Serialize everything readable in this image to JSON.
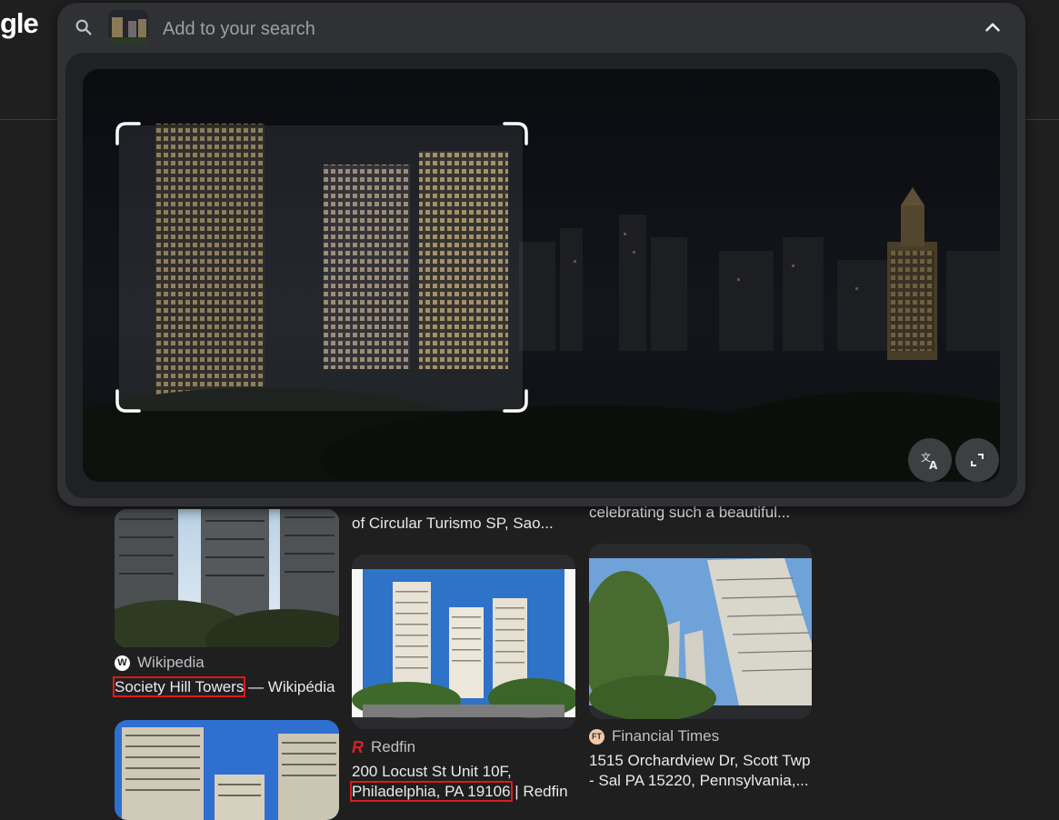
{
  "page": {
    "logo_fragment": "gle"
  },
  "search": {
    "placeholder": "Add to your search",
    "collapse_icon": "chevron-up-icon",
    "translate_icon": "translate-icon",
    "fullscreen_icon": "expand-icon"
  },
  "results": [
    {
      "snippet_above": "",
      "source": "Wikipedia",
      "favicon": "W",
      "title_highlight": "Society Hill Towers",
      "title_rest": " — Wikipédia"
    },
    {
      "snippet_above": "",
      "source": "",
      "favicon": "",
      "title_highlight": "",
      "title_rest": ""
    },
    {
      "snippet_above": "of Circular Turismo SP, Sao...",
      "source": "Redfin",
      "favicon": "R",
      "title_line1": "200 Locust St Unit 10F,",
      "title_highlight": "Philadelphia, PA 19106",
      "title_rest": " | Redfin"
    },
    {
      "snippet_above": "celebrating such a beautiful...",
      "source": "Financial Times",
      "favicon": "FT",
      "title_line1": "1515 Orchardview Dr, Scott Twp",
      "title_line2": "- Sal PA 15220, Pennsylvania,..."
    }
  ],
  "colors": {
    "highlight_box": "#e01919",
    "redfin_red": "#d32323",
    "ft_pink": "#f2c9a8"
  }
}
